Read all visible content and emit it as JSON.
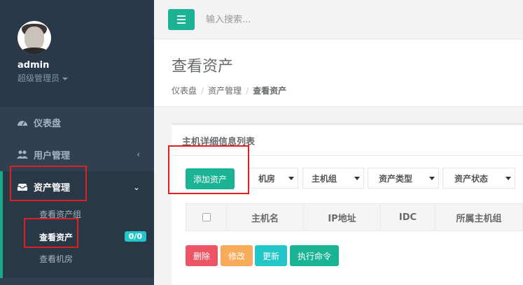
{
  "user": {
    "name": "admin",
    "role": "超级管理员"
  },
  "nav": {
    "dashboard": "仪表盘",
    "users": "用户管理",
    "assets": "资产管理",
    "sub": {
      "asset_group": "查看资产组",
      "view_assets": "查看资产",
      "view_assets_badge": "0/0",
      "view_idc": "查看机房"
    }
  },
  "topbar": {
    "search_placeholder": "输入搜索..."
  },
  "page": {
    "title": "查看资产",
    "breadcrumb": [
      "仪表盘",
      "资产管理",
      "查看资产"
    ]
  },
  "panel": {
    "title": "主机详细信息列表",
    "add_button": "添加资产",
    "filters": [
      "机房",
      "主机组",
      "资产类型",
      "资产状态"
    ],
    "columns": [
      "主机名",
      "IP地址",
      "IDC",
      "所属主机组"
    ],
    "actions": [
      "删除",
      "修改",
      "更新",
      "执行命令"
    ]
  },
  "colors": {
    "primary": "#1ab394",
    "danger": "#ed5565",
    "warning": "#f8ac59",
    "info": "#23c6c8",
    "sidebar": "#2f4050"
  }
}
